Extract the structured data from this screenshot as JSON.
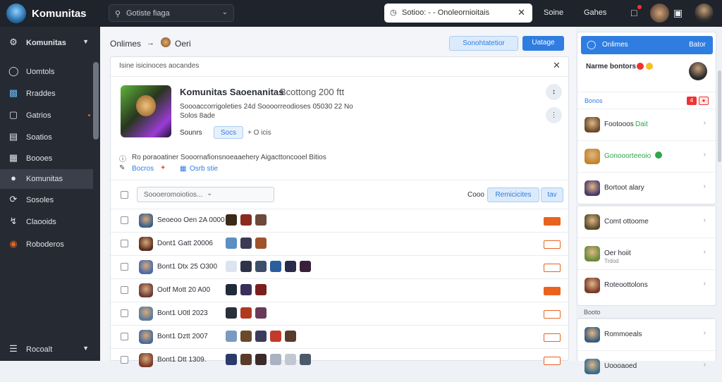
{
  "topbar": {
    "brand": "Komunitas",
    "search_placeholder": "Gotiste fiaga",
    "tab_title": "Sotioo: - -  Onoleornioitais",
    "links": [
      "Soine",
      "Gahes"
    ]
  },
  "sidebar": {
    "header": "Komunitas",
    "items": [
      {
        "label": "Uomtols",
        "icon": "gauge-icon"
      },
      {
        "label": "Rraddes",
        "icon": "chart-icon"
      },
      {
        "label": "Gatrios",
        "icon": "monitor-icon"
      },
      {
        "label": "Soatios",
        "icon": "list-icon"
      },
      {
        "label": "Boooes",
        "icon": "calendar-icon"
      },
      {
        "label": "Komunitas",
        "icon": "community-icon"
      },
      {
        "label": "Sosoles",
        "icon": "refresh-icon"
      },
      {
        "label": "Claooids",
        "icon": "paperclip-icon"
      },
      {
        "label": "Roboderos",
        "icon": "shield-icon"
      }
    ],
    "footer": "Rocoalt"
  },
  "main": {
    "crumb_first": "Onlimes",
    "crumb_sep": "→",
    "crumb_second": "Oeri",
    "btn_secondary": "Sonohtatetior",
    "btn_primary": "Uatage",
    "card_header": "Isine isicinoces  aocandes",
    "hero": {
      "title": "Komunitas Saoenanitas",
      "title_extra": "Bcottong 200 ftt",
      "desc": "Soooaccorrigoleties 24d Soooorreodioses 05030 22 No",
      "meta": "Solos 8ade",
      "tag_label": "Sounrs",
      "tag_btn": "Socs",
      "tag_after": "+ O icis"
    },
    "info_line": "Ro poraoatiner  Sooornafionsnoeaaehery  Aigacttoncooel Bitios",
    "link_line_1": "Bocros",
    "link_line_2": "Osrb stie",
    "filter_placeholder": "Soooeromoiotios...",
    "filter_label": "Cooo",
    "filter_btn": "Remicicites",
    "filter_btn_small": "tav",
    "rows": [
      {
        "name": "Seoeoo Oen 2A 0000",
        "thumbs": [
          "#3b2a1a",
          "#8a2b1e",
          "#6b4a3a"
        ],
        "act": "#e9631e",
        "act_fill": true,
        "av": "#3a5f8a"
      },
      {
        "name": "Dont1 Gatt 20006",
        "thumbs": [
          "#5c8fc2",
          "#3c3a55",
          "#a0522d"
        ],
        "act": "#e9631e",
        "act_fill": false,
        "av": "#5a2d1e"
      },
      {
        "name": "Bont1 Dtx 25 O300",
        "thumbs": [
          "#dde4f1",
          "#2f3348",
          "#3d4f6a",
          "#2a5e9c",
          "#2a2a4a",
          "#3a1f3a"
        ],
        "act": "#e9631e",
        "act_fill": false,
        "av": "#4a6aa8"
      },
      {
        "name": "Ootf Mott 20 A00",
        "thumbs": [
          "#1f2a3a",
          "#3a2f5a",
          "#7a1f1f"
        ],
        "act": "#e9631e",
        "act_fill": true,
        "av": "#6a3a3a"
      },
      {
        "name": "Bont1 U0tl 2023",
        "thumbs": [
          "#2a2f3a",
          "#b03a1e",
          "#6a3a5a"
        ],
        "act": "#e9631e",
        "act_fill": false,
        "av": "#5a7a9a"
      },
      {
        "name": "Bont1 Dztt 2007",
        "thumbs": [
          "#7a9ac2",
          "#6a4a2a",
          "#3a3a5a",
          "#c23a2a",
          "#5a3a2a"
        ],
        "act": "#e9631e",
        "act_fill": false,
        "av": "#4a6a9a"
      },
      {
        "name": "Bont1 Dtt 1309.",
        "thumbs": [
          "#2a3a6a",
          "#5a3a2a",
          "#3a2a2a",
          "#aab2c2",
          "#c2c8d2",
          "#4a5a6a"
        ],
        "act": "#e9631e",
        "act_fill": false,
        "av": "#7a3a2a"
      }
    ]
  },
  "right": {
    "header_btn": "Onlimes",
    "header_btn_right": "Bator",
    "user_name": "Narme bontors",
    "section_label": "Bonos",
    "section_badge_1": "4",
    "items": [
      {
        "label": "Footooos",
        "extra": "Dait",
        "color": "#6a4a2a"
      },
      {
        "label": "Gonooorteeoio",
        "extra": "",
        "color": "#c2842a"
      },
      {
        "label": "Bortoot alary",
        "extra": "",
        "color": "#4a3a6a"
      }
    ],
    "items2": [
      {
        "label": "Comt ottoome",
        "color": "#5a4a2a",
        "sub": ""
      },
      {
        "label": "Oer hoiit",
        "color": "#6a8a3a",
        "sub": "Trdod"
      },
      {
        "label": "Roteoottolons",
        "color": "#7a3a2a",
        "sub": ""
      }
    ],
    "section2_label": "Booto",
    "items3": [
      {
        "label": "Rommoeals",
        "color": "#3a5a7a"
      },
      {
        "label": "Uoooaoed",
        "color": "#3a6a8a"
      }
    ]
  },
  "colors": {
    "accent": "#2f7de1",
    "dark": "#1f232b",
    "orange": "#e9631e",
    "green": "#2fa74a"
  }
}
